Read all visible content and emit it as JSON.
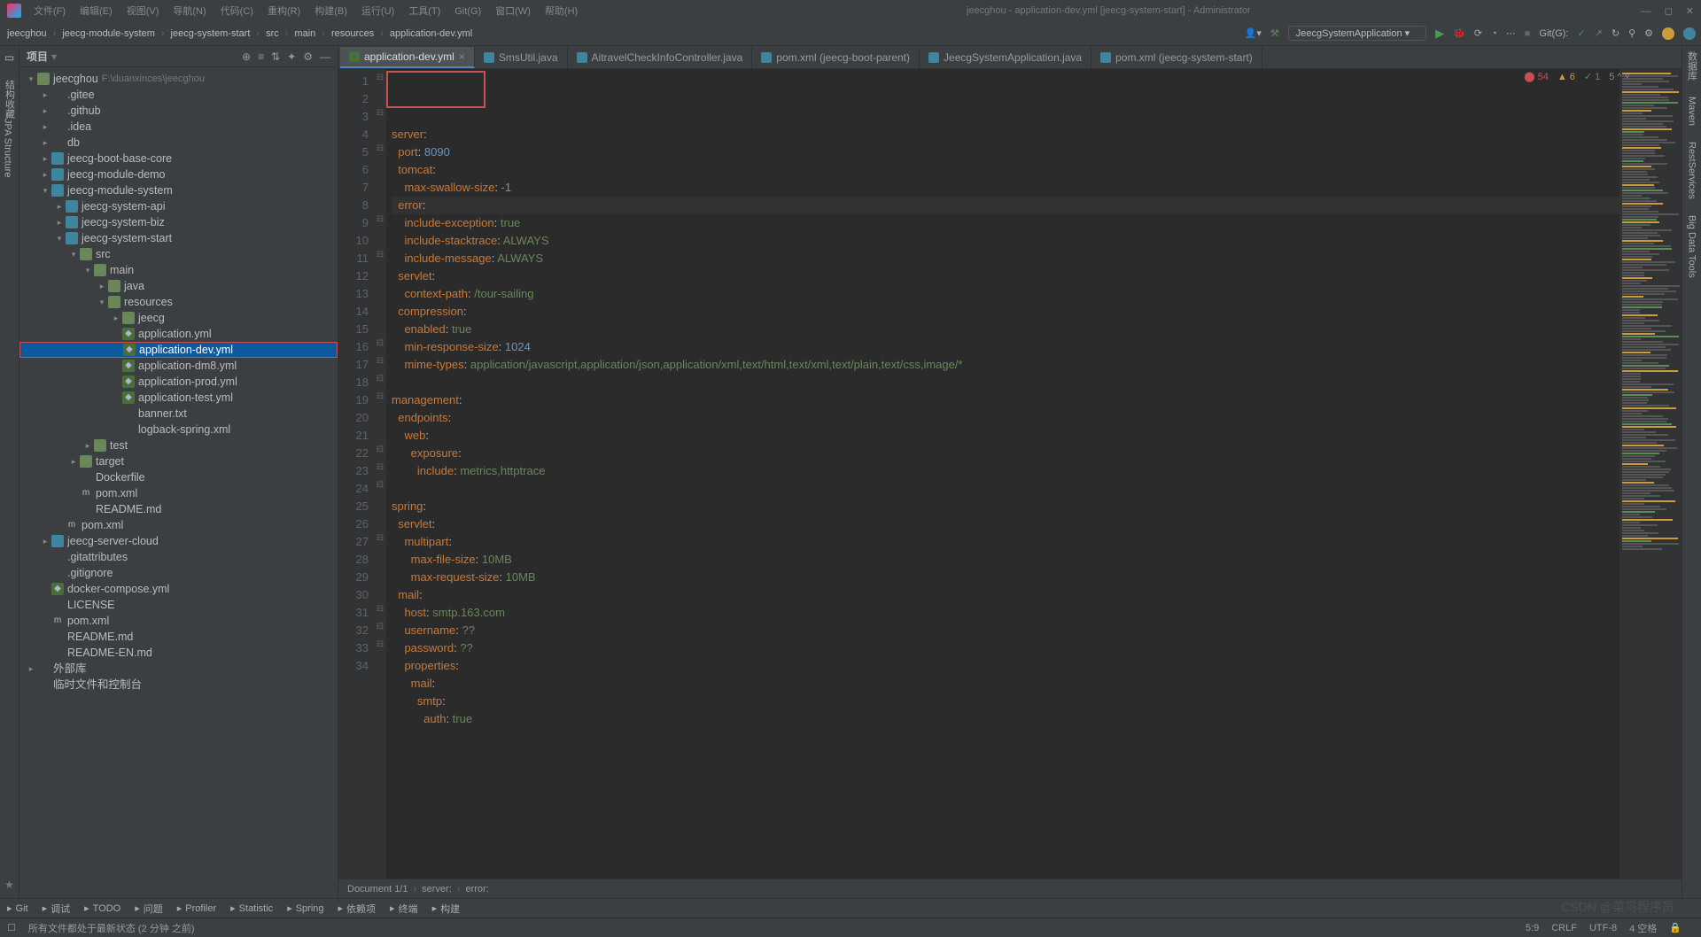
{
  "window": {
    "title": "jeecghou - application-dev.yml [jeecg-system-start] - Administrator"
  },
  "menu": [
    "文件(F)",
    "编辑(E)",
    "视图(V)",
    "导航(N)",
    "代码(C)",
    "重构(R)",
    "构建(B)",
    "运行(U)",
    "工具(T)",
    "Git(G)",
    "窗口(W)",
    "帮助(H)"
  ],
  "breadcrumb": [
    "jeecghou",
    "jeecg-module-system",
    "jeecg-system-start",
    "src",
    "main",
    "resources",
    "application-dev.yml"
  ],
  "runConfig": "JeecgSystemApplication",
  "gitLabel": "Git(G):",
  "panel": {
    "title": "项目"
  },
  "tree": [
    {
      "d": 0,
      "a": "v",
      "i": "folder",
      "t": "jeecghou",
      "dim": "F:\\duanxinces\\jeecghou"
    },
    {
      "d": 1,
      "a": ">",
      "i": "folder-o",
      "t": ".gitee"
    },
    {
      "d": 1,
      "a": ">",
      "i": "folder-o",
      "t": ".github"
    },
    {
      "d": 1,
      "a": ">",
      "i": "folder-o",
      "t": ".idea"
    },
    {
      "d": 1,
      "a": ">",
      "i": "folder-o",
      "t": "db"
    },
    {
      "d": 1,
      "a": ">",
      "i": "mod",
      "t": "jeecg-boot-base-core"
    },
    {
      "d": 1,
      "a": ">",
      "i": "mod",
      "t": "jeecg-module-demo"
    },
    {
      "d": 1,
      "a": "v",
      "i": "mod",
      "t": "jeecg-module-system"
    },
    {
      "d": 2,
      "a": ">",
      "i": "mod",
      "t": "jeecg-system-api"
    },
    {
      "d": 2,
      "a": ">",
      "i": "mod",
      "t": "jeecg-system-biz"
    },
    {
      "d": 2,
      "a": "v",
      "i": "mod",
      "t": "jeecg-system-start"
    },
    {
      "d": 3,
      "a": "v",
      "i": "folder",
      "t": "src"
    },
    {
      "d": 4,
      "a": "v",
      "i": "folder",
      "t": "main"
    },
    {
      "d": 5,
      "a": ">",
      "i": "folder",
      "t": "java"
    },
    {
      "d": 5,
      "a": "v",
      "i": "folder",
      "t": "resources"
    },
    {
      "d": 6,
      "a": ">",
      "i": "folder",
      "t": "jeecg"
    },
    {
      "d": 6,
      "a": "",
      "i": "yml",
      "t": "application.yml"
    },
    {
      "d": 6,
      "a": "",
      "i": "yml",
      "t": "application-dev.yml",
      "sel": true
    },
    {
      "d": 6,
      "a": "",
      "i": "yml",
      "t": "application-dm8.yml"
    },
    {
      "d": 6,
      "a": "",
      "i": "yml",
      "t": "application-prod.yml"
    },
    {
      "d": 6,
      "a": "",
      "i": "yml",
      "t": "application-test.yml"
    },
    {
      "d": 6,
      "a": "",
      "i": "txt",
      "t": "banner.txt"
    },
    {
      "d": 6,
      "a": "",
      "i": "txt",
      "t": "logback-spring.xml"
    },
    {
      "d": 4,
      "a": ">",
      "i": "folder",
      "t": "test"
    },
    {
      "d": 3,
      "a": ">",
      "i": "folder",
      "t": "target"
    },
    {
      "d": 3,
      "a": "",
      "i": "txt",
      "t": "Dockerfile"
    },
    {
      "d": 3,
      "a": "",
      "i": "m",
      "t": "pom.xml"
    },
    {
      "d": 3,
      "a": "",
      "i": "txt",
      "t": "README.md"
    },
    {
      "d": 2,
      "a": "",
      "i": "m",
      "t": "pom.xml"
    },
    {
      "d": 1,
      "a": ">",
      "i": "mod",
      "t": "jeecg-server-cloud"
    },
    {
      "d": 1,
      "a": "",
      "i": "txt",
      "t": ".gitattributes"
    },
    {
      "d": 1,
      "a": "",
      "i": "txt",
      "t": ".gitignore"
    },
    {
      "d": 1,
      "a": "",
      "i": "yml",
      "t": "docker-compose.yml"
    },
    {
      "d": 1,
      "a": "",
      "i": "txt",
      "t": "LICENSE"
    },
    {
      "d": 1,
      "a": "",
      "i": "m",
      "t": "pom.xml"
    },
    {
      "d": 1,
      "a": "",
      "i": "txt",
      "t": "README.md"
    },
    {
      "d": 1,
      "a": "",
      "i": "txt",
      "t": "README-EN.md"
    },
    {
      "d": 0,
      "a": ">",
      "i": "folder-o",
      "t": "外部库"
    },
    {
      "d": 0,
      "a": "",
      "i": "folder-o",
      "t": "临时文件和控制台"
    }
  ],
  "tabs": [
    {
      "i": "yml",
      "t": "application-dev.yml",
      "active": true
    },
    {
      "i": "java",
      "t": "SmsUtil.java"
    },
    {
      "i": "java",
      "t": "AitravelCheckInfoController.java"
    },
    {
      "i": "m",
      "t": "pom.xml (jeecg-boot-parent)"
    },
    {
      "i": "java",
      "t": "JeecgSystemApplication.java"
    },
    {
      "i": "m",
      "t": "pom.xml (jeecg-system-start)"
    }
  ],
  "inspections": {
    "errors": "54",
    "warnings": "6",
    "weak": "1",
    "typos": "5"
  },
  "code": {
    "lines": [
      {
        "n": 1,
        "f": "-",
        "seg": [
          [
            "k",
            "server"
          ],
          [
            "p",
            ":"
          ]
        ]
      },
      {
        "n": 2,
        "f": "",
        "seg": [
          [
            "p",
            "  "
          ],
          [
            "k",
            "port"
          ],
          [
            "p",
            ": "
          ],
          [
            "n",
            "8090"
          ]
        ]
      },
      {
        "n": 3,
        "f": "-",
        "seg": [
          [
            "p",
            "  "
          ],
          [
            "k",
            "tomcat"
          ],
          [
            "p",
            ":"
          ]
        ]
      },
      {
        "n": 4,
        "f": "",
        "seg": [
          [
            "p",
            "    "
          ],
          [
            "k",
            "max-swallow-size"
          ],
          [
            "p",
            ": "
          ],
          [
            "n",
            "-1"
          ]
        ]
      },
      {
        "n": 5,
        "f": "-",
        "cur": true,
        "seg": [
          [
            "p",
            "  "
          ],
          [
            "k",
            "error"
          ],
          [
            "p",
            ":"
          ]
        ]
      },
      {
        "n": 6,
        "f": "",
        "seg": [
          [
            "p",
            "    "
          ],
          [
            "k",
            "include-exception"
          ],
          [
            "p",
            ": "
          ],
          [
            "s",
            "true"
          ]
        ]
      },
      {
        "n": 7,
        "f": "",
        "seg": [
          [
            "p",
            "    "
          ],
          [
            "k",
            "include-stacktrace"
          ],
          [
            "p",
            ": "
          ],
          [
            "s",
            "ALWAYS"
          ]
        ]
      },
      {
        "n": 8,
        "f": "",
        "seg": [
          [
            "p",
            "    "
          ],
          [
            "k",
            "include-message"
          ],
          [
            "p",
            ": "
          ],
          [
            "s",
            "ALWAYS"
          ]
        ]
      },
      {
        "n": 9,
        "f": "-",
        "seg": [
          [
            "p",
            "  "
          ],
          [
            "k",
            "servlet"
          ],
          [
            "p",
            ":"
          ]
        ]
      },
      {
        "n": 10,
        "f": "",
        "seg": [
          [
            "p",
            "    "
          ],
          [
            "k",
            "context-path"
          ],
          [
            "p",
            ": "
          ],
          [
            "s",
            "/tour-sailing"
          ]
        ]
      },
      {
        "n": 11,
        "f": "-",
        "seg": [
          [
            "p",
            "  "
          ],
          [
            "k",
            "compression"
          ],
          [
            "p",
            ":"
          ]
        ]
      },
      {
        "n": 12,
        "f": "",
        "seg": [
          [
            "p",
            "    "
          ],
          [
            "k",
            "enabled"
          ],
          [
            "p",
            ": "
          ],
          [
            "s",
            "true"
          ]
        ]
      },
      {
        "n": 13,
        "f": "",
        "seg": [
          [
            "p",
            "    "
          ],
          [
            "k",
            "min-response-size"
          ],
          [
            "p",
            ": "
          ],
          [
            "n",
            "1024"
          ]
        ]
      },
      {
        "n": 14,
        "f": "",
        "seg": [
          [
            "p",
            "    "
          ],
          [
            "k",
            "mime-types"
          ],
          [
            "p",
            ": "
          ],
          [
            "s",
            "application/javascript,application/json,application/xml,text/html,text/xml,text/plain,text/css,image/*"
          ]
        ]
      },
      {
        "n": 15,
        "f": "",
        "seg": []
      },
      {
        "n": 16,
        "f": "-",
        "seg": [
          [
            "k",
            "management"
          ],
          [
            "p",
            ":"
          ]
        ]
      },
      {
        "n": 17,
        "f": "-",
        "seg": [
          [
            "p",
            "  "
          ],
          [
            "k",
            "endpoints"
          ],
          [
            "p",
            ":"
          ]
        ]
      },
      {
        "n": 18,
        "f": "-",
        "seg": [
          [
            "p",
            "    "
          ],
          [
            "k",
            "web"
          ],
          [
            "p",
            ":"
          ]
        ]
      },
      {
        "n": 19,
        "f": "-",
        "seg": [
          [
            "p",
            "      "
          ],
          [
            "k",
            "exposure"
          ],
          [
            "p",
            ":"
          ]
        ]
      },
      {
        "n": 20,
        "f": "",
        "seg": [
          [
            "p",
            "        "
          ],
          [
            "k",
            "include"
          ],
          [
            "p",
            ": "
          ],
          [
            "s",
            "metrics,httptrace"
          ]
        ]
      },
      {
        "n": 21,
        "f": "",
        "seg": []
      },
      {
        "n": 22,
        "f": "-",
        "seg": [
          [
            "k",
            "spring"
          ],
          [
            "p",
            ":"
          ]
        ]
      },
      {
        "n": 23,
        "f": "-",
        "seg": [
          [
            "p",
            "  "
          ],
          [
            "k",
            "servlet"
          ],
          [
            "p",
            ":"
          ]
        ]
      },
      {
        "n": 24,
        "f": "-",
        "seg": [
          [
            "p",
            "    "
          ],
          [
            "k",
            "multipart"
          ],
          [
            "p",
            ":"
          ]
        ]
      },
      {
        "n": 25,
        "f": "",
        "seg": [
          [
            "p",
            "      "
          ],
          [
            "k",
            "max-file-size"
          ],
          [
            "p",
            ": "
          ],
          [
            "s",
            "10MB"
          ]
        ]
      },
      {
        "n": 26,
        "f": "",
        "seg": [
          [
            "p",
            "      "
          ],
          [
            "k",
            "max-request-size"
          ],
          [
            "p",
            ": "
          ],
          [
            "s",
            "10MB"
          ]
        ]
      },
      {
        "n": 27,
        "f": "-",
        "seg": [
          [
            "p",
            "  "
          ],
          [
            "k",
            "mail"
          ],
          [
            "p",
            ":"
          ]
        ]
      },
      {
        "n": 28,
        "f": "",
        "seg": [
          [
            "p",
            "    "
          ],
          [
            "k",
            "host"
          ],
          [
            "p",
            ": "
          ],
          [
            "s",
            "smtp.163.com"
          ]
        ]
      },
      {
        "n": 29,
        "f": "",
        "seg": [
          [
            "p",
            "    "
          ],
          [
            "k",
            "username"
          ],
          [
            "p",
            ": "
          ],
          [
            "s",
            "??"
          ]
        ]
      },
      {
        "n": 30,
        "f": "",
        "seg": [
          [
            "p",
            "    "
          ],
          [
            "k",
            "password"
          ],
          [
            "p",
            ": "
          ],
          [
            "s",
            "??"
          ]
        ]
      },
      {
        "n": 31,
        "f": "-",
        "seg": [
          [
            "p",
            "    "
          ],
          [
            "k",
            "properties"
          ],
          [
            "p",
            ":"
          ]
        ]
      },
      {
        "n": 32,
        "f": "-",
        "seg": [
          [
            "p",
            "      "
          ],
          [
            "k",
            "mail"
          ],
          [
            "p",
            ":"
          ]
        ]
      },
      {
        "n": 33,
        "f": "-",
        "seg": [
          [
            "p",
            "        "
          ],
          [
            "k",
            "smtp"
          ],
          [
            "p",
            ":"
          ]
        ]
      },
      {
        "n": 34,
        "f": "",
        "seg": [
          [
            "p",
            "          "
          ],
          [
            "k",
            "auth"
          ],
          [
            "p",
            ": "
          ],
          [
            "s",
            "true"
          ]
        ]
      }
    ]
  },
  "editorFooter": {
    "doc": "Document 1/1",
    "p1": "server:",
    "p2": "error:"
  },
  "bottomTools": [
    "Git",
    "调试",
    "TODO",
    "问题",
    "Profiler",
    "Statistic",
    "Spring",
    "依赖项",
    "终端",
    "构建"
  ],
  "status": {
    "left": "所有文件都处于最新状态 (2 分钟 之前)",
    "pos": "5:9",
    "eol": "CRLF",
    "enc": "UTF-8",
    "indent": "4 空格"
  },
  "watermark": "CSDN @菜鸟程序员",
  "rightTools": [
    "数据库",
    "Maven",
    "RestServices",
    "Big Data Tools"
  ],
  "leftTools": [
    "结构",
    "收藏",
    "JPA Structure"
  ]
}
